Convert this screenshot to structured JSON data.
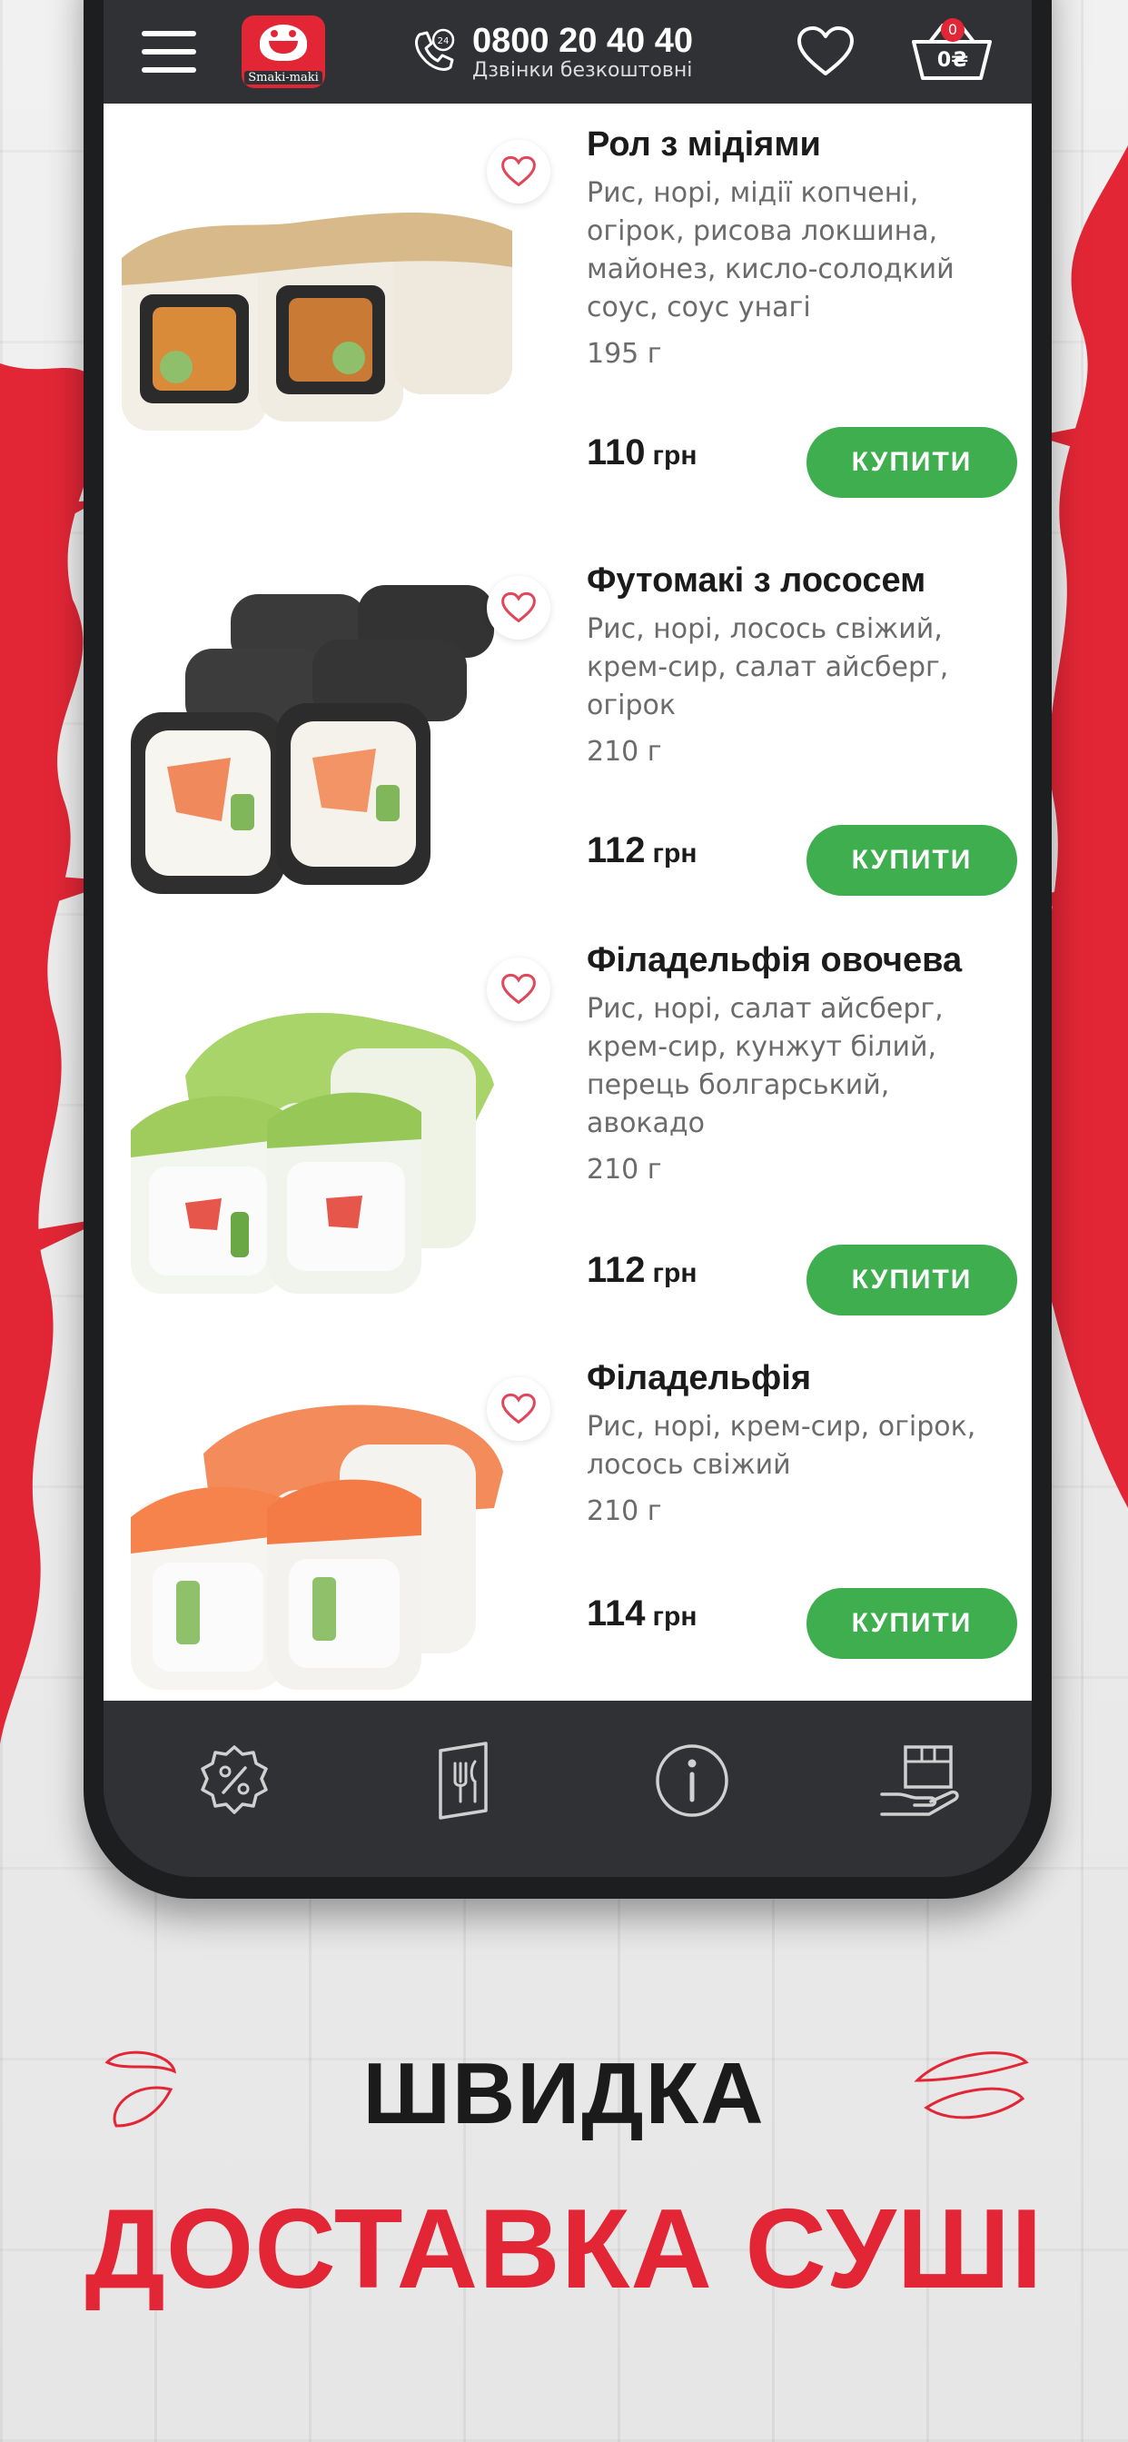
{
  "header": {
    "logo_text": "Smaki-maki",
    "phone": "0800 20 40 40",
    "phone_note": "Дзвінки безкоштовні",
    "cart_count": "0",
    "cart_total": "0₴"
  },
  "products": [
    {
      "title": "Рол з мідіями",
      "description": "Рис, норі, мідії копчені, огірок, рисова локшина, майонез, кисло-солодкий соус, соус унагі",
      "weight": "195 г",
      "price": "110",
      "currency": "грн",
      "buy_label": "КУПИТИ",
      "topping": "sesame"
    },
    {
      "title": "Футомакі з лососем",
      "description": "Рис, норі, лосось свіжий, крем-сир, салат айсберг, огірок",
      "weight": "210 г",
      "price": "112",
      "currency": "грн",
      "buy_label": "КУПИТИ",
      "topping": "nori"
    },
    {
      "title": "Філадельфія овочева",
      "description": "Рис, норі, салат айсберг, крем-сир, кунжут білий, перець болгарський, авокадо",
      "weight": "210 г",
      "price": "112",
      "currency": "грн",
      "buy_label": "КУПИТИ",
      "topping": "avocado"
    },
    {
      "title": "Філадельфія",
      "description": "Рис, норі, крем-сир, огірок, лосось свіжий",
      "weight": "210 г",
      "price": "114",
      "currency": "грн",
      "buy_label": "КУПИТИ",
      "topping": "salmon"
    }
  ],
  "bottom_nav": [
    {
      "icon": "discount-badge-icon"
    },
    {
      "icon": "menu-book-icon"
    },
    {
      "icon": "info-icon"
    },
    {
      "icon": "delivery-box-icon"
    }
  ],
  "tagline": {
    "line1": "ШВИДКА",
    "line2": "ДОСТАВКА СУШІ"
  },
  "colors": {
    "accent_red": "#e32636",
    "buy_green": "#3fae4f",
    "bar_dark": "#2f3134"
  }
}
